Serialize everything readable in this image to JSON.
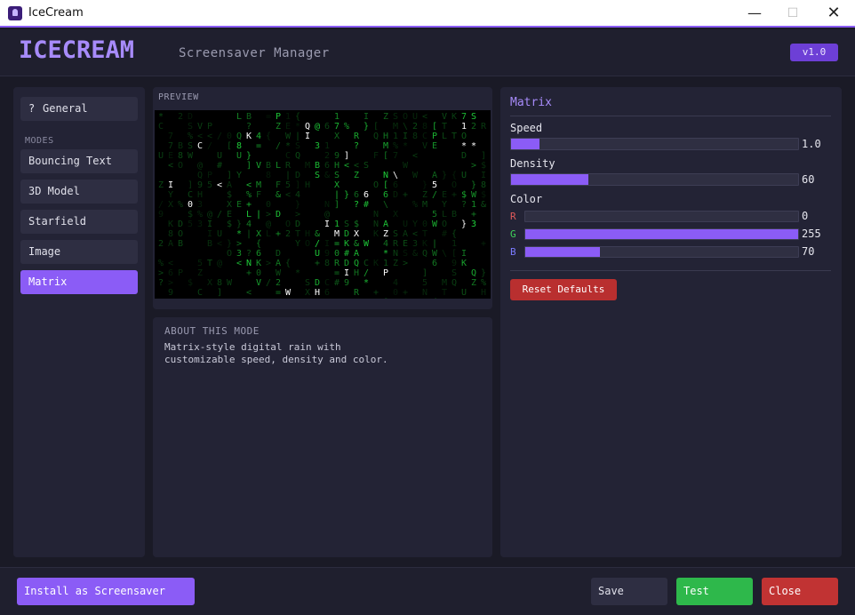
{
  "window": {
    "title": "IceCream",
    "minimize": "—",
    "maximize": "☐",
    "close": "✕"
  },
  "header": {
    "logo": "ICECREAM",
    "subtitle": "Screensaver Manager",
    "version": "v1.0"
  },
  "sidebar": {
    "general_icon": "?",
    "general_label": "General",
    "modes_label": "MODES",
    "modes": [
      {
        "label": "Bouncing Text"
      },
      {
        "label": "3D Model"
      },
      {
        "label": "Starfield"
      },
      {
        "label": "Image"
      },
      {
        "label": "Matrix",
        "active": true
      }
    ]
  },
  "preview": {
    "label": "PREVIEW",
    "glyph_color": "#1fd13a"
  },
  "about": {
    "label": "ABOUT THIS MODE",
    "line1": "Matrix-style digital rain with",
    "line2": "customizable speed, density and color."
  },
  "settings": {
    "title": "Matrix",
    "speed": {
      "label": "Speed",
      "value": "1.0",
      "fraction": 0.1
    },
    "density": {
      "label": "Density",
      "value": "60",
      "fraction": 0.27
    },
    "color": {
      "label": "Color",
      "r": {
        "label": "R",
        "value": "0",
        "fraction": 0.0,
        "color": "#e05a5a"
      },
      "g": {
        "label": "G",
        "value": "255",
        "fraction": 1.0,
        "color": "#3fd35a"
      },
      "b": {
        "label": "B",
        "value": "70",
        "fraction": 0.275,
        "color": "#7b7bff"
      }
    },
    "reset_label": "Reset Defaults"
  },
  "footer": {
    "install_label": "Install as Screensaver",
    "save_label": "Save",
    "test_label": "Test",
    "close_label": "Close"
  }
}
